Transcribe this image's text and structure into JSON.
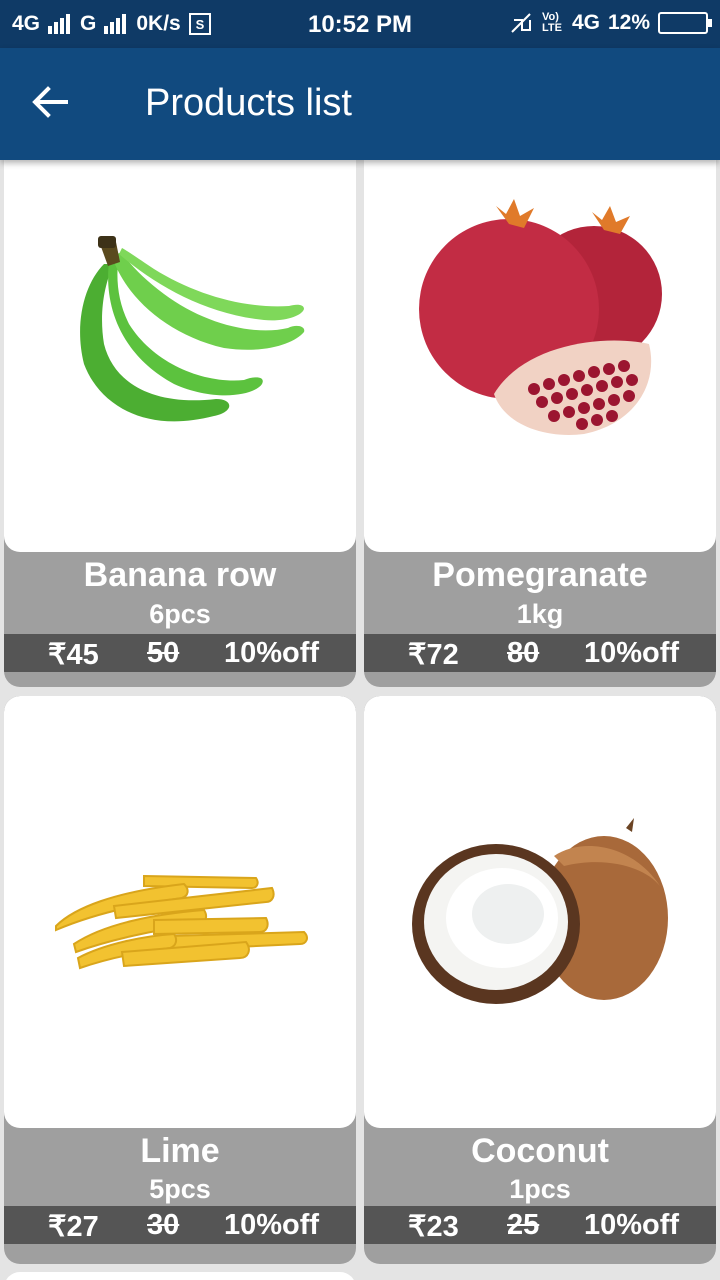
{
  "status": {
    "network1": "4G",
    "network2": "G",
    "speed": "0K/s",
    "time": "10:52 PM",
    "volte": "Vo) LTE",
    "network3": "4G",
    "battery": "12%"
  },
  "header": {
    "title": "Products list"
  },
  "products": [
    {
      "name": "Banana row",
      "qty": "6pcs",
      "price": "₹45",
      "mrp": "50",
      "discount": "10%off",
      "image": "green-banana-bunch"
    },
    {
      "name": "Pomegranate",
      "qty": "1kg",
      "price": "₹72",
      "mrp": "80",
      "discount": "10%off",
      "image": "pomegranate"
    },
    {
      "name": "Lime",
      "qty": "5pcs",
      "price": "₹27",
      "mrp": "30",
      "discount": "10%off",
      "image": "baby-corn"
    },
    {
      "name": "Coconut",
      "qty": "1pcs",
      "price": "₹23",
      "mrp": "25",
      "discount": "10%off",
      "image": "coconut"
    }
  ],
  "colors": {
    "status_bar": "#0f3a66",
    "app_bar": "#114a7f",
    "card_footer": "#9f9f9f",
    "price_bar": "#555555"
  }
}
